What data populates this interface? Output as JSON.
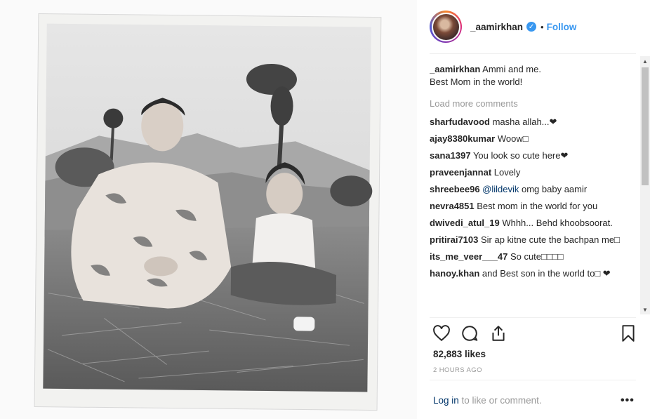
{
  "post": {
    "username": "_aamirkhan",
    "verified_icon": "verified-badge-icon",
    "dot": "•",
    "follow_label": "Follow",
    "caption_user": "_aamirkhan",
    "caption_line1": "Ammi and me.",
    "caption_line2": "Best Mom in the world!",
    "load_more": "Load more comments",
    "likes": "82,883 likes",
    "time": "2 HOURS AGO",
    "login_link": "Log in",
    "login_rest": " to like or comment.",
    "more_label": "•••"
  },
  "comments": [
    {
      "user": "sharfudavood",
      "text": " masha allah...❤"
    },
    {
      "user": "ajay8380kumar",
      "text": " Woow□"
    },
    {
      "user": "sana1397",
      "text": " You look so cute here❤"
    },
    {
      "user": "praveenjannat",
      "text": " Lovely"
    },
    {
      "user": "shreebee96",
      "mention": " @lildevik",
      "text": " omg baby aamir"
    },
    {
      "user": "nevra4851",
      "text": " Best mom in the world for you"
    },
    {
      "user": "dwivedi_atul_19",
      "text": " Whhh... Behd khoobsoorat."
    },
    {
      "user": "pritirai7103",
      "text": " Sir ap kitne cute the bachpan me□"
    },
    {
      "user": "its_me_veer___47",
      "text": " So cute□□□□"
    },
    {
      "user": "hanoy.khan",
      "text": " and Best son in the world to□ ❤"
    }
  ],
  "icons": {
    "like": "heart-icon",
    "comment": "comment-icon",
    "share": "share-icon",
    "save": "bookmark-icon"
  },
  "colors": {
    "link": "#3897f0",
    "muted": "#999999",
    "text": "#262626"
  }
}
